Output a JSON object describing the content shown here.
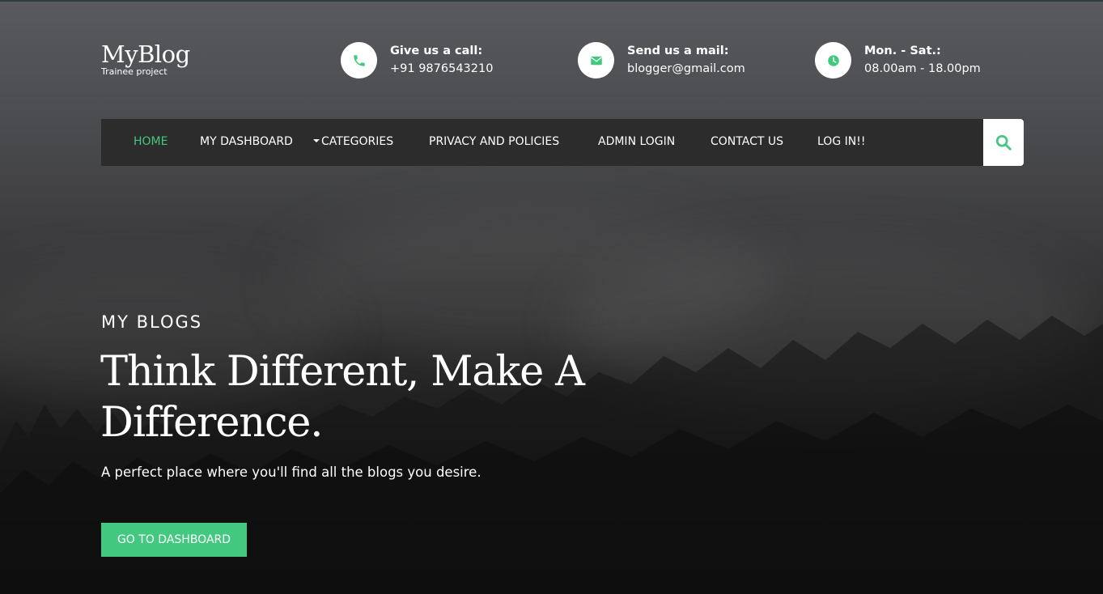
{
  "brand": {
    "title": "MyBlog",
    "subtitle": "Trainee project"
  },
  "contacts": [
    {
      "icon": "phone-icon",
      "label": "Give us a call:",
      "value": "+91 9876543210"
    },
    {
      "icon": "mail-icon",
      "label": "Send us a mail:",
      "value": "blogger@gmail.com"
    },
    {
      "icon": "clock-icon",
      "label": "Mon. - Sat.:",
      "value": "08.00am - 18.00pm"
    }
  ],
  "nav": {
    "items": [
      {
        "label": "HOME",
        "active": true
      },
      {
        "label": "MY DASHBOARD"
      },
      {
        "label": "CATEGORIES",
        "dropdown": true
      },
      {
        "label": "PRIVACY AND POLICIES"
      },
      {
        "label": "ADMIN LOGIN"
      },
      {
        "label": "CONTACT US"
      },
      {
        "label": "LOG IN!!"
      }
    ],
    "search_icon": "search-icon"
  },
  "hero": {
    "kicker": "MY BLOGS",
    "headline": "Think Different, Make A Difference.",
    "subline": "A perfect place where you'll find all the blogs you desire.",
    "cta_label": "GO TO DASHBOARD"
  },
  "colors": {
    "accent": "#43c97f",
    "navbar": "#2c2c2d",
    "text": "#ffffff"
  }
}
